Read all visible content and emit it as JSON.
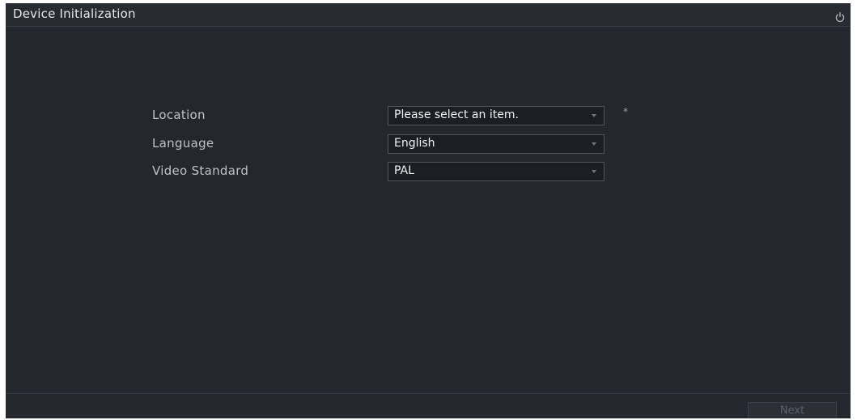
{
  "window": {
    "title": "Device Initialization",
    "power_icon": "power-icon"
  },
  "form": {
    "fields": [
      {
        "label": "Location",
        "value": "Please select an item.",
        "required_mark": "*"
      },
      {
        "label": "Language",
        "value": "English"
      },
      {
        "label": "Video Standard",
        "value": "PAL"
      }
    ]
  },
  "footer": {
    "next_label": "Next",
    "next_enabled": false
  },
  "colors": {
    "background": "#24272d",
    "field_background": "#1c1e23",
    "field_border": "#50555e",
    "label_text": "#bfc2c7",
    "value_text": "#f2f3f5",
    "disabled_button_text": "#5a5f68"
  }
}
